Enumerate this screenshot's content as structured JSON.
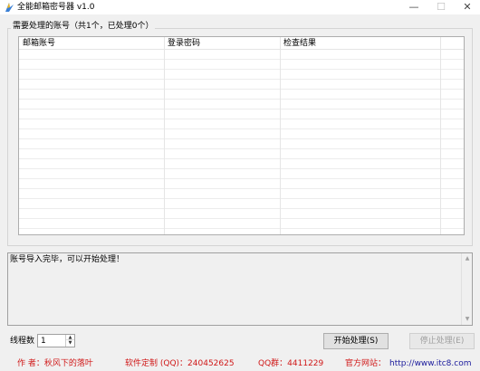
{
  "window": {
    "title": "全能邮箱密号器 v1.0",
    "icon": "app-icon",
    "buttons": {
      "minimize": "—",
      "maximize": "☐",
      "close": "✕"
    }
  },
  "accounts": {
    "group_title": "需要处理的账号（共1个，已处理0个）",
    "columns": [
      "邮箱账号",
      "登录密码",
      "检查结果"
    ],
    "rows": []
  },
  "log": {
    "text": "账号导入完毕，可以开始处理！"
  },
  "controls": {
    "threads_label": "线程数",
    "threads_value": "1",
    "start_label": "开始处理(S)",
    "stop_label": "停止处理(E)"
  },
  "footer": {
    "author": "作  者：秋风下的落叶",
    "custom": "软件定制 (QQ)：240452625",
    "qq_group": "QQ群：4411229",
    "website_label": "官方网站：",
    "website_url": "http://www.itc8.com"
  },
  "colors": {
    "accent_red": "#d01818",
    "link_blue": "#1a1a9c",
    "window_bg": "#f0f0f0"
  }
}
